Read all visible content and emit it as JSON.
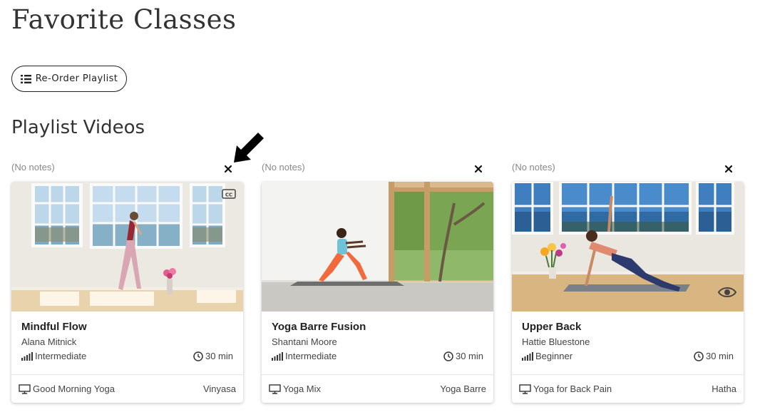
{
  "page": {
    "title": "Favorite Classes"
  },
  "toolbar": {
    "reorder_label": "Re-Order Playlist"
  },
  "section": {
    "title": "Playlist Videos"
  },
  "cards": [
    {
      "notes": "(No notes)",
      "title": "Mindful Flow",
      "teacher": "Alana Mitnick",
      "level": "Intermediate",
      "duration": "30 min",
      "series": "Good Morning Yoga",
      "style": "Vinyasa",
      "badge": "cc-icon"
    },
    {
      "notes": "(No notes)",
      "title": "Yoga Barre Fusion",
      "teacher": "Shantani Moore",
      "level": "Intermediate",
      "duration": "30 min",
      "series": "Yoga Mix",
      "style": "Yoga Barre",
      "badge": ""
    },
    {
      "notes": "(No notes)",
      "title": "Upper Back",
      "teacher": "Hattie Bluestone",
      "level": "Beginner",
      "duration": "30 min",
      "series": "Yoga for Back Pain",
      "style": "Hatha",
      "badge": "eye-icon"
    }
  ],
  "colors": {
    "text": "#222222",
    "muted": "#888888",
    "border": "#e6e6e6"
  }
}
